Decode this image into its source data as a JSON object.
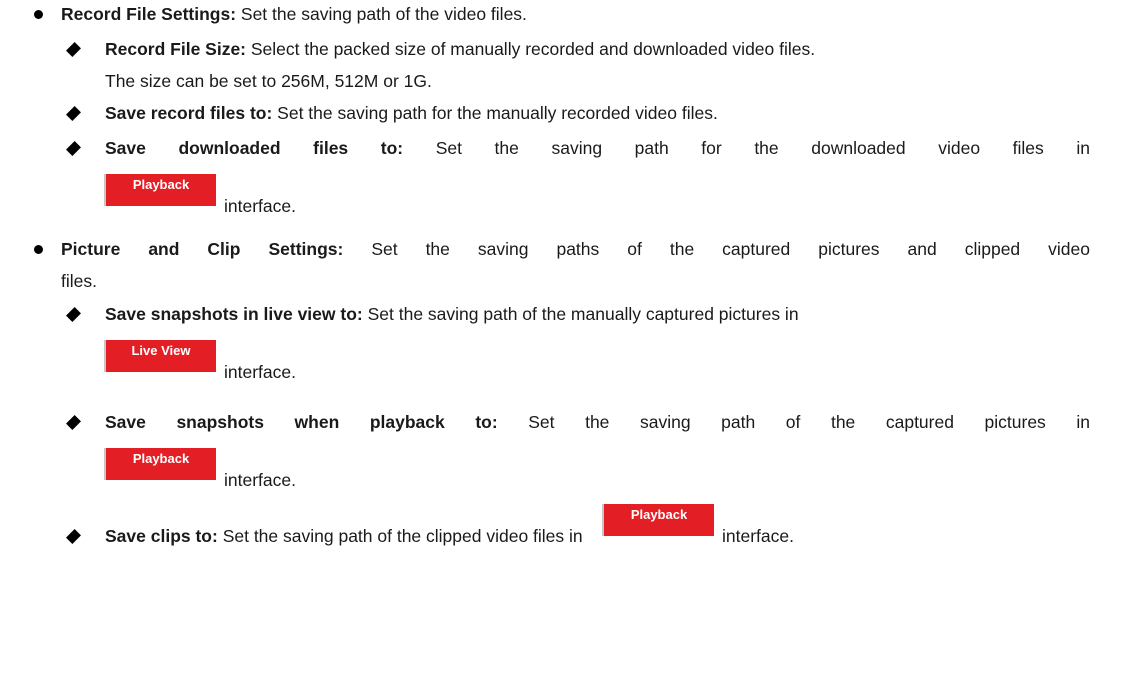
{
  "sections": [
    {
      "heading": "Record File Settings:",
      "text": " Set the saving path of the video files.",
      "items": [
        {
          "heading": "Record File Size:",
          "text": " Select the packed size of manually recorded and downloaded video files.",
          "continuation": "The size can be set to 256M, 512M or 1G."
        },
        {
          "heading": "Save record files to:",
          "text": " Set the saving path for the manually recorded video files."
        },
        {
          "heading": "Save downloaded files to:",
          "text": " Set the saving path for the downloaded video files in",
          "button": "Playback",
          "suffix": "interface."
        }
      ]
    },
    {
      "heading": "Picture and Clip Settings:",
      "text": " Set the saving paths of the captured pictures and clipped video",
      "continuation": "files.",
      "items": [
        {
          "heading": "Save snapshots in live view to:",
          "text": " Set the saving path of the manually captured pictures in",
          "button": "Live View",
          "suffix": "interface."
        },
        {
          "heading": "Save snapshots when playback to:",
          "text": " Set the saving path of the captured pictures in",
          "button": "Playback",
          "suffix": "interface."
        },
        {
          "heading": "Save clips to:",
          "text": " Set the saving path of the clipped video files in",
          "button": "Playback",
          "suffix": "interface."
        }
      ]
    }
  ],
  "colors": {
    "button_bg": "#e31e24",
    "button_text": "#ffffff",
    "text": "#1a1a1a"
  },
  "icons": {
    "level1_bullet": "filled-circle",
    "level2_bullet": "filled-diamond"
  }
}
